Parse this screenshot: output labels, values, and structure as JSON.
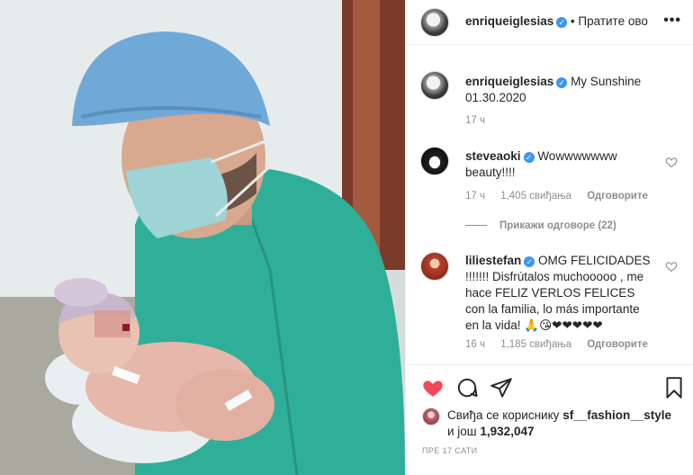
{
  "post": {
    "author": "enriqueiglesias",
    "follow_label": "• Пратите ово",
    "more_icon": "more-horizontal-icon",
    "caption_text": "My Sunshine",
    "caption_date": "01.30.2020",
    "caption_time": "17 ч",
    "posted_ago": "ПРЕ 17 САТИ"
  },
  "comments": [
    {
      "user": "steveaoki",
      "text": "Wowwwwwww beauty!!!!",
      "time": "17 ч",
      "likes": "1,405 свиђања",
      "reply_label": "Одговорите",
      "view_replies": "Прикажи одговоре (22)"
    },
    {
      "user": "liliestefan",
      "text": "OMG FELICIDADES !!!!!!! Disfrútalos muchooooo , me hace FELIZ VERLOS FELICES con la familia, lo más importante en la vida! 🙏😘❤❤❤❤❤",
      "time": "16 ч",
      "likes": "1,185 свиђања",
      "reply_label": "Одговорите"
    }
  ],
  "actions": {
    "like_icon": "heart-filled-icon",
    "comment_icon": "comment-bubble-icon",
    "share_icon": "paper-plane-icon",
    "save_icon": "bookmark-icon"
  },
  "likes": {
    "prefix": "Свиђа се кориснику",
    "liker": "sf__fashion__style",
    "and_more": "и још",
    "count": "1,932,047"
  },
  "colors": {
    "like_red": "#ed4956",
    "verified_blue": "#3897f0",
    "muted_gray": "#8e8e8e",
    "scrubs_green": "#2faf98"
  }
}
